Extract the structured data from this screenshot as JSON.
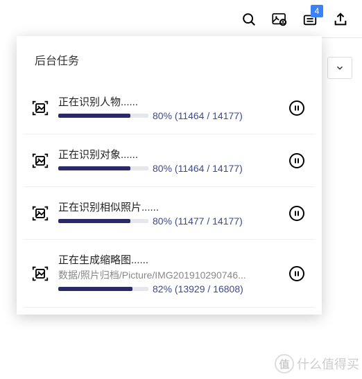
{
  "toolbar": {
    "badge_count": "4"
  },
  "panel": {
    "title": "后台任务"
  },
  "tasks": [
    {
      "label": "正在识别人物......",
      "path": "",
      "percent": 80,
      "progress_text": "80% (11464 / 14177)"
    },
    {
      "label": "正在识别对象......",
      "path": "",
      "percent": 80,
      "progress_text": "80% (11464 / 14177)"
    },
    {
      "label": "正在识别相似照片......",
      "path": "",
      "percent": 80,
      "progress_text": "80% (11477 / 14177)"
    },
    {
      "label": "正在生成缩略图......",
      "path": "数据/照片归档/Picture/IMG201910290746...",
      "percent": 82,
      "progress_text": "82% (13929 / 16808)"
    }
  ],
  "watermark": {
    "text": "什么值得买",
    "glyph": "值"
  }
}
